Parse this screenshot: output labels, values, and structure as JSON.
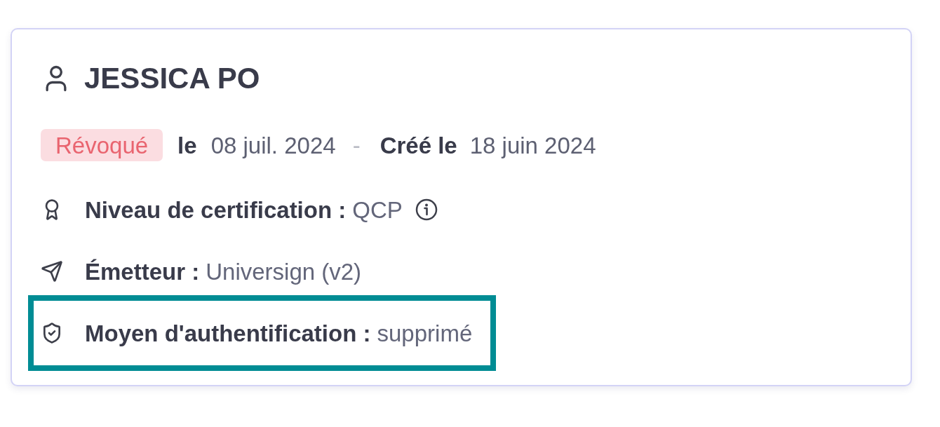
{
  "card": {
    "title": "JESSICA PO",
    "status": {
      "badge": "Révoqué",
      "kind": "revoked",
      "date_label": "le",
      "date": "08 juil. 2024"
    },
    "separator": "-",
    "created": {
      "label": "Créé le",
      "date": "18 juin 2024"
    },
    "details": [
      {
        "label": "Niveau de certification :",
        "value": "QCP",
        "info": true,
        "highlighted": false
      },
      {
        "label": "Émetteur :",
        "value": "Universign (v2)",
        "info": false,
        "highlighted": false
      },
      {
        "label": "Moyen d'authentification :",
        "value": "supprimé",
        "info": false,
        "highlighted": true
      }
    ]
  }
}
